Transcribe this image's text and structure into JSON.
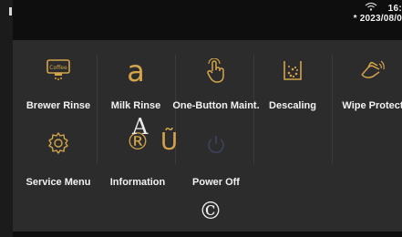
{
  "status": {
    "time": "16:",
    "date": "* 2023/08/0"
  },
  "menu": {
    "items": [
      {
        "label": "Brewer Rinse",
        "icon": "coffee-brewer-icon"
      },
      {
        "label": "Milk Rinse",
        "icon": "milk-rinse-icon",
        "glyph": "a"
      },
      {
        "label": "One-Button Maint.",
        "icon": "hand-touch-icon"
      },
      {
        "label": "Descaling",
        "icon": "descaling-icon"
      },
      {
        "label": "Wipe Protect",
        "icon": "wipe-hand-icon"
      },
      {
        "label": "Service Menu",
        "icon": "gear-icon"
      },
      {
        "label": "Information",
        "icon": "info-icon",
        "glyph": "®"
      },
      {
        "label": "Power Off",
        "icon": "power-icon"
      }
    ]
  },
  "overlay": {
    "letter_a": "A",
    "copyright": "©",
    "power_glyph": "Ũ"
  },
  "colors": {
    "accent": "#d4a44b",
    "panel": "#2c2c2c",
    "text": "#f2f2f2"
  }
}
